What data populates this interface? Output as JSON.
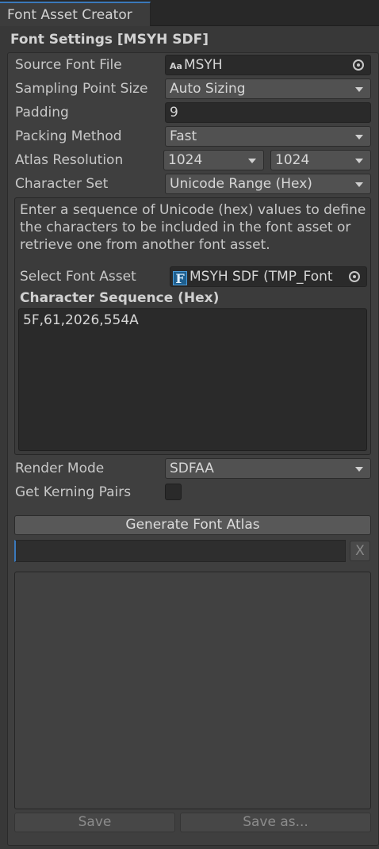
{
  "window": {
    "tab_title": "Font Asset Creator"
  },
  "section_title": "Font Settings [MSYH SDF]",
  "source_font_file": {
    "label": "Source Font File",
    "icon_text": "Aa",
    "value": "MSYH"
  },
  "sampling_point_size": {
    "label": "Sampling Point Size",
    "value": "Auto Sizing"
  },
  "padding": {
    "label": "Padding",
    "value": "9"
  },
  "packing_method": {
    "label": "Packing Method",
    "value": "Fast"
  },
  "atlas_resolution": {
    "label": "Atlas Resolution",
    "width": "1024",
    "height": "1024"
  },
  "character_set": {
    "label": "Character Set",
    "value": "Unicode Range (Hex)"
  },
  "help_text": "Enter a sequence of Unicode (hex) values to define the characters to be included in the font asset or retrieve one from another font asset.",
  "select_font_asset": {
    "label": "Select Font Asset",
    "icon_text": "F",
    "value": "MSYH SDF (TMP_Font"
  },
  "character_sequence": {
    "label": "Character Sequence (Hex)",
    "value": "5F,61,2026,554A"
  },
  "render_mode": {
    "label": "Render Mode",
    "value": "SDFAA"
  },
  "get_kerning_pairs": {
    "label": "Get Kerning Pairs",
    "checked": false
  },
  "generate_button": "Generate Font Atlas",
  "clear_button": "X",
  "save_button": "Save",
  "save_as_button": "Save as...",
  "colors": {
    "accent": "#3a79bb",
    "background": "#383838",
    "panel": "#3f3f3f",
    "field": "#2a2a2a"
  }
}
